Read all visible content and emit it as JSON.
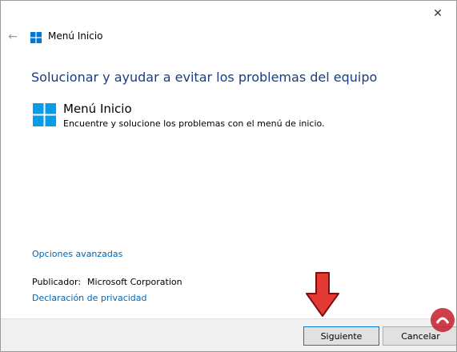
{
  "window": {
    "title": "Menú Inicio",
    "close_glyph": "✕",
    "back_glyph": "←"
  },
  "main": {
    "heading": "Solucionar y ayudar a evitar los problemas del equipo",
    "item_title": "Menú Inicio",
    "item_description": "Encuentre y solucione los problemas con el menú de inicio."
  },
  "links": {
    "advanced": "Opciones avanzadas",
    "privacy": "Declaración de privacidad"
  },
  "publisher": {
    "label": "Publicador:",
    "value": "Microsoft Corporation"
  },
  "footer": {
    "next_label": "Siguiente",
    "cancel_label": "Cancelar"
  },
  "colors": {
    "accent": "#0078d7",
    "heading": "#1a3d80",
    "link": "#0066b4",
    "arrow": "#e53935"
  },
  "icons": [
    "back-arrow-icon",
    "windows-logo-icon",
    "close-icon",
    "red-arrow-pointer-icon",
    "watermark-icon"
  ]
}
